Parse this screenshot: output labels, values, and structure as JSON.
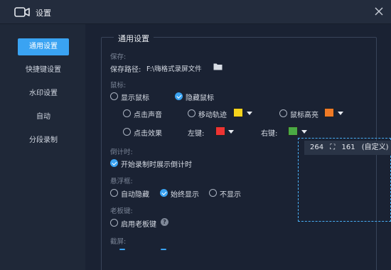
{
  "window": {
    "title": "设置",
    "icon": "camera-icon"
  },
  "sidebar": {
    "items": [
      {
        "label": "通用设置",
        "active": true
      },
      {
        "label": "快捷键设置",
        "active": false
      },
      {
        "label": "水印设置",
        "active": false
      },
      {
        "label": "自动",
        "active": false
      },
      {
        "label": "分段录制",
        "active": false
      }
    ]
  },
  "panel": {
    "title": "通用设置"
  },
  "save": {
    "section": "保存:",
    "path_label": "保存路径:",
    "path_value": "F:\\嗨格式录屏文件",
    "folder_icon": "folder-icon"
  },
  "mouse": {
    "section": "鼠标:",
    "show_label": "显示鼠标",
    "hide_label": "隐藏鼠标",
    "click_sound": "点击声音",
    "move_trail": "移动轨迹",
    "trail_color": "#f5d31c",
    "highlight": "鼠标高亮",
    "highlight_color": "#f07a26",
    "click_effect": "点击效果",
    "left_key": "左键:",
    "left_color": "#ee3333",
    "right_key": "右键:",
    "right_color": "#4aaa44"
  },
  "countdown": {
    "section": "倒计时:",
    "label": "开始录制时展示倒计时"
  },
  "floating": {
    "section": "悬浮框:",
    "options": [
      "自动隐藏",
      "始终显示",
      "不显示"
    ]
  },
  "boss_key": {
    "section": "老板键:",
    "label": "启用老板键"
  },
  "screenshot": {
    "section": "截屏:"
  },
  "overlay": {
    "width": "264",
    "height": "161",
    "mode": "(自定义)"
  }
}
